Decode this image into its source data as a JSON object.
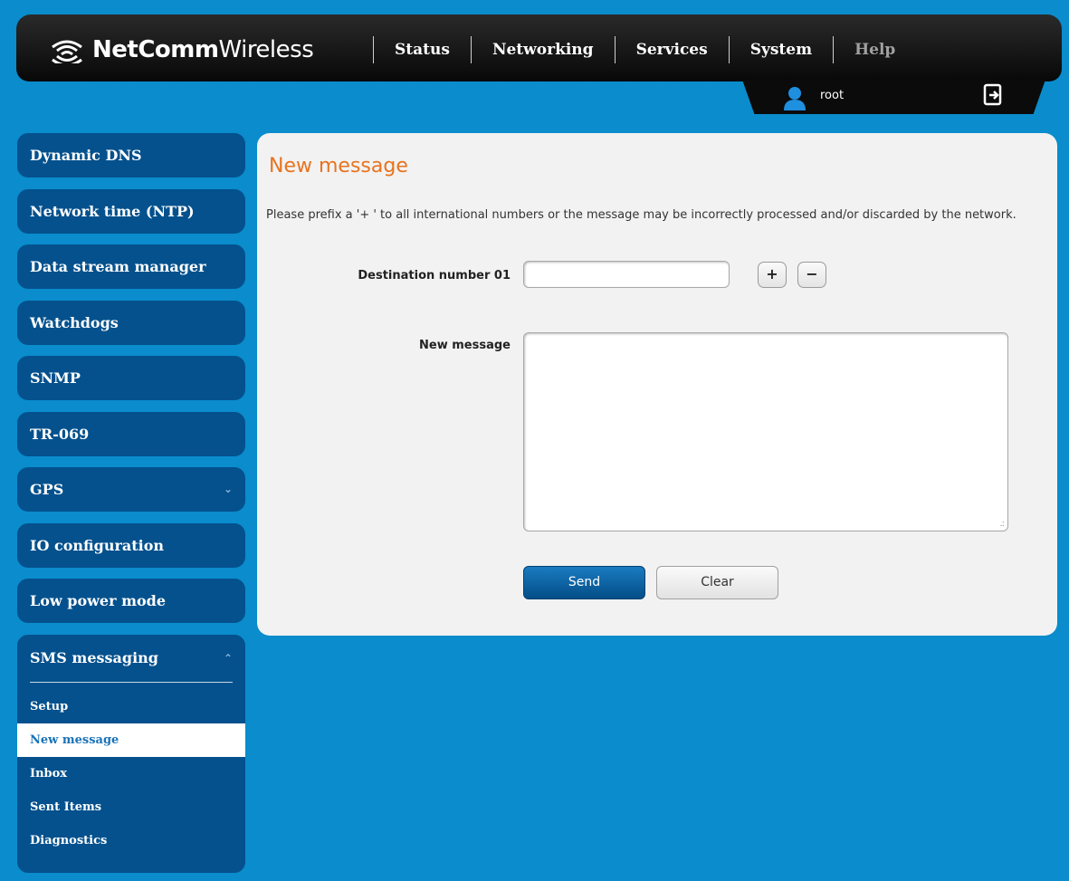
{
  "header": {
    "brand_bold": "NetComm",
    "brand_light": "Wireless",
    "nav": [
      {
        "label": "Status"
      },
      {
        "label": "Networking"
      },
      {
        "label": "Services"
      },
      {
        "label": "System"
      },
      {
        "label": "Help"
      }
    ],
    "username": "root"
  },
  "sidebar": {
    "items": [
      {
        "label": "Dynamic DNS"
      },
      {
        "label": "Network time (NTP)"
      },
      {
        "label": "Data stream manager"
      },
      {
        "label": "Watchdogs"
      },
      {
        "label": "SNMP"
      },
      {
        "label": "TR-069"
      },
      {
        "label": "GPS"
      },
      {
        "label": "IO configuration"
      },
      {
        "label": "Low power mode"
      }
    ],
    "group": {
      "label": "SMS messaging",
      "subitems": [
        {
          "label": "Setup"
        },
        {
          "label": "New message"
        },
        {
          "label": "Inbox"
        },
        {
          "label": "Sent Items"
        },
        {
          "label": "Diagnostics"
        }
      ],
      "active": "New message"
    }
  },
  "main": {
    "title": "New message",
    "note": "Please prefix a '+ ' to all international numbers or the message may be incorrectly processed and/or discarded by the network.",
    "destination_label": "Destination number 01",
    "destination_value": "",
    "add_label": "+",
    "remove_label": "−",
    "message_label": "New message",
    "message_value": "",
    "send_label": "Send",
    "clear_label": "Clear"
  },
  "colors": {
    "background": "#0a8ccd",
    "sidebar": "#04518d",
    "title": "#e8731f"
  }
}
